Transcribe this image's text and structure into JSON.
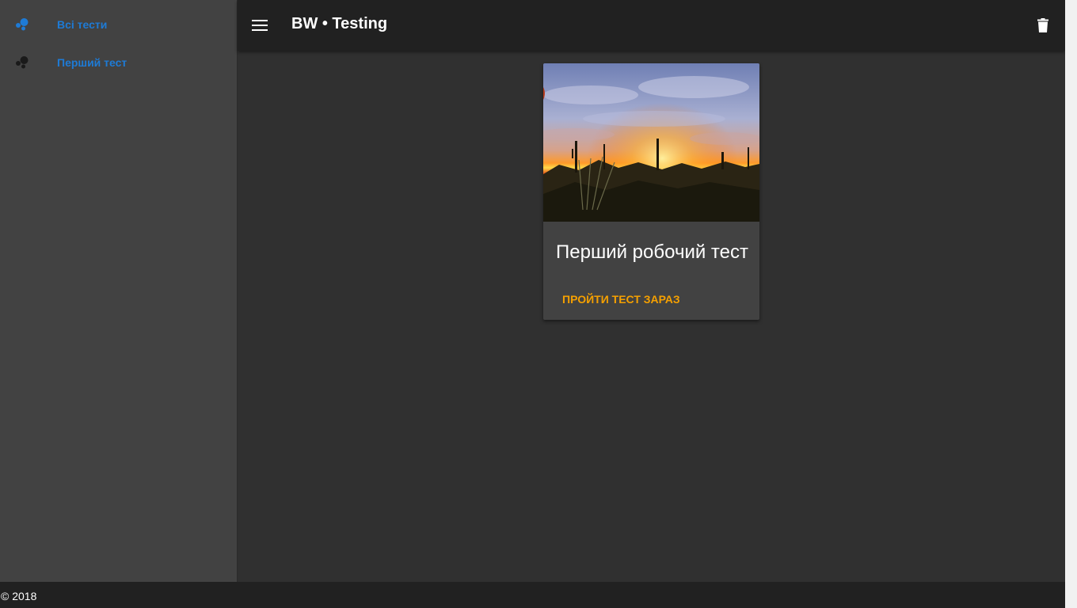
{
  "sidebar": {
    "items": [
      {
        "label": "Всі тести",
        "icon": "bubbles-icon",
        "icon_color": "#1e7bd6"
      },
      {
        "label": "Перший тест",
        "icon": "bubbles-icon",
        "icon_color": "#1a1a1a"
      }
    ]
  },
  "header": {
    "title": "BW • Testing",
    "menu_icon": "menu-icon",
    "delete_icon": "trash-icon"
  },
  "main": {
    "cards": [
      {
        "title": "Перший робочий тест",
        "action_label": "ПРОЙТИ ТЕСТ ЗАРАЗ",
        "action_color": "#f5a000"
      }
    ]
  },
  "footer": {
    "copyright": "© 2018"
  },
  "colors": {
    "accent": "#1e7bd6",
    "action": "#f5a000",
    "background": "#303030",
    "surface": "#424242",
    "appbar": "#212121"
  }
}
